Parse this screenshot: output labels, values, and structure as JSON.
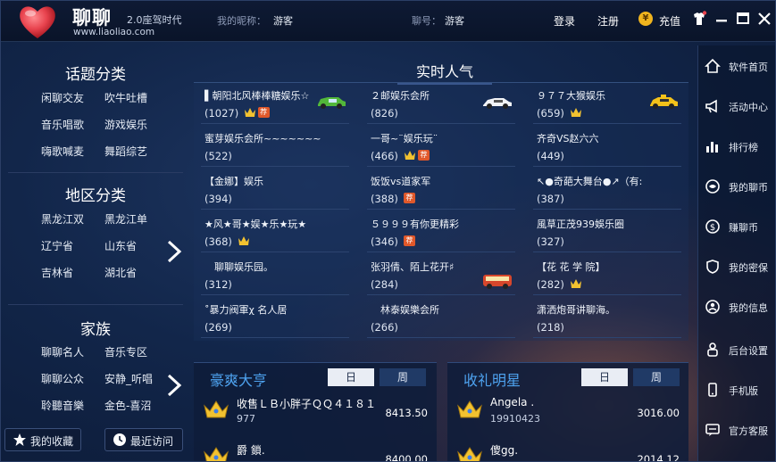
{
  "header": {
    "app_name": "聊聊",
    "slogan": "2.0座驾时代",
    "url": "www.liaoliao.com",
    "nickname_label": "我的昵称：",
    "nickname_value": "游客",
    "account_label": "聊号：",
    "account_value": "游客",
    "login_label": "登录",
    "register_label": "注册",
    "recharge_label": "充值",
    "colors": {
      "heart": "#e8434e",
      "accent": "#4ea3f0"
    }
  },
  "left": {
    "topic_title": "话题分类",
    "topic_items": [
      "闲聊交友",
      "吹牛吐槽",
      "音乐唱歌",
      "游戏娱乐",
      "嗨歌喊麦",
      "舞蹈综艺"
    ],
    "region_title": "地区分类",
    "region_items": [
      "黑龙江双",
      "黑龙江单",
      "辽宁省",
      "山东省",
      "吉林省",
      "湖北省"
    ],
    "family_title": "家族",
    "family_items": [
      "聊聊名人",
      "音乐专区",
      "聊聊公众",
      "安静_听唱",
      "聆聽音樂",
      "金色-喜沼"
    ],
    "favorites_label": "我的收藏",
    "recent_label": "最近访问"
  },
  "hot": {
    "title": "实时人气",
    "rooms": [
      {
        "name": "▌朝阳北风棒棒糖娱乐☆",
        "count": "(1027)",
        "crown": true,
        "tag": true,
        "car": "green-car-icon"
      },
      {
        "name": "２邮娱乐会所",
        "count": "(826)",
        "crown": false,
        "tag": false,
        "car": "white-car-icon"
      },
      {
        "name": "９７７大猴娱乐",
        "count": "(659)",
        "crown": true,
        "tag": false,
        "car": "taxi-icon"
      },
      {
        "name": "蜜芽娱乐会所~~~~~~~",
        "count": "(522)",
        "crown": false,
        "tag": false,
        "car": ""
      },
      {
        "name": "一哥~¨娱乐玩¨",
        "count": "(466)",
        "crown": true,
        "tag": true,
        "car": ""
      },
      {
        "name": "齐奇VS赵六六",
        "count": "(449)",
        "crown": false,
        "tag": false,
        "car": ""
      },
      {
        "name": "【金娜】娱乐",
        "count": "(394)",
        "crown": false,
        "tag": false,
        "car": ""
      },
      {
        "name": "饭饭vs道家军",
        "count": "(388)",
        "crown": false,
        "tag": true,
        "car": ""
      },
      {
        "name": "↖●奇葩大舞台●↗（有:",
        "count": "(387)",
        "crown": false,
        "tag": false,
        "car": ""
      },
      {
        "name": "★风★哥★娱★乐★玩★",
        "count": "(368)",
        "crown": true,
        "tag": false,
        "car": ""
      },
      {
        "name": "５９９９有你更精彩",
        "count": "(346)",
        "crown": false,
        "tag": true,
        "car": ""
      },
      {
        "name": "風草正茂939娛乐圈",
        "count": "(327)",
        "crown": false,
        "tag": false,
        "car": ""
      },
      {
        "name": "　聊聊娱乐园。",
        "count": "(312)",
        "crown": false,
        "tag": false,
        "car": ""
      },
      {
        "name": "张羽倩、陌上花开♯",
        "count": "(284)",
        "crown": false,
        "tag": false,
        "car": "bus-icon"
      },
      {
        "name": "【花 花 学 院】",
        "count": "(282)",
        "crown": true,
        "tag": false,
        "car": ""
      },
      {
        "name": "˚暴力阀軍χ 名人居",
        "count": "(269)",
        "crown": false,
        "tag": false,
        "car": ""
      },
      {
        "name": "　林泰娱樂会所",
        "count": "(266)",
        "crown": false,
        "tag": false,
        "car": ""
      },
      {
        "name": "潇洒炮哥讲聊海。",
        "count": "(218)",
        "crown": false,
        "tag": false,
        "car": ""
      }
    ]
  },
  "rank_rich": {
    "title": "豪爽大亨",
    "tab_day": "日",
    "tab_week": "周",
    "rows": [
      {
        "name": "收售ＬＢ小胖子ＱＱ４１８１",
        "id": "977",
        "score": "8413.50"
      },
      {
        "name": "爵  鎖.",
        "id": "",
        "score": "8400.00"
      }
    ]
  },
  "rank_star": {
    "title": "收礼明星",
    "tab_day": "日",
    "tab_week": "周",
    "rows": [
      {
        "name": "Angela .",
        "id": "19910423",
        "score": "3016.00"
      },
      {
        "name": "傻gg.",
        "id": "",
        "score": "2014.12"
      }
    ]
  },
  "sidebar": {
    "items": [
      {
        "label": "软件首页",
        "icon": "home-icon"
      },
      {
        "label": "活动中心",
        "icon": "megaphone-icon"
      },
      {
        "label": "排行榜",
        "icon": "bar-chart-icon"
      },
      {
        "label": "我的聊币",
        "icon": "coin-icon"
      },
      {
        "label": "赚聊币",
        "icon": "dollar-icon"
      },
      {
        "label": "我的密保",
        "icon": "shield-icon"
      },
      {
        "label": "我的信息",
        "icon": "user-info-icon"
      },
      {
        "label": "后台设置",
        "icon": "settings-icon"
      },
      {
        "label": "手机版",
        "icon": "phone-icon"
      },
      {
        "label": "官方客服",
        "icon": "chat-icon"
      }
    ]
  }
}
